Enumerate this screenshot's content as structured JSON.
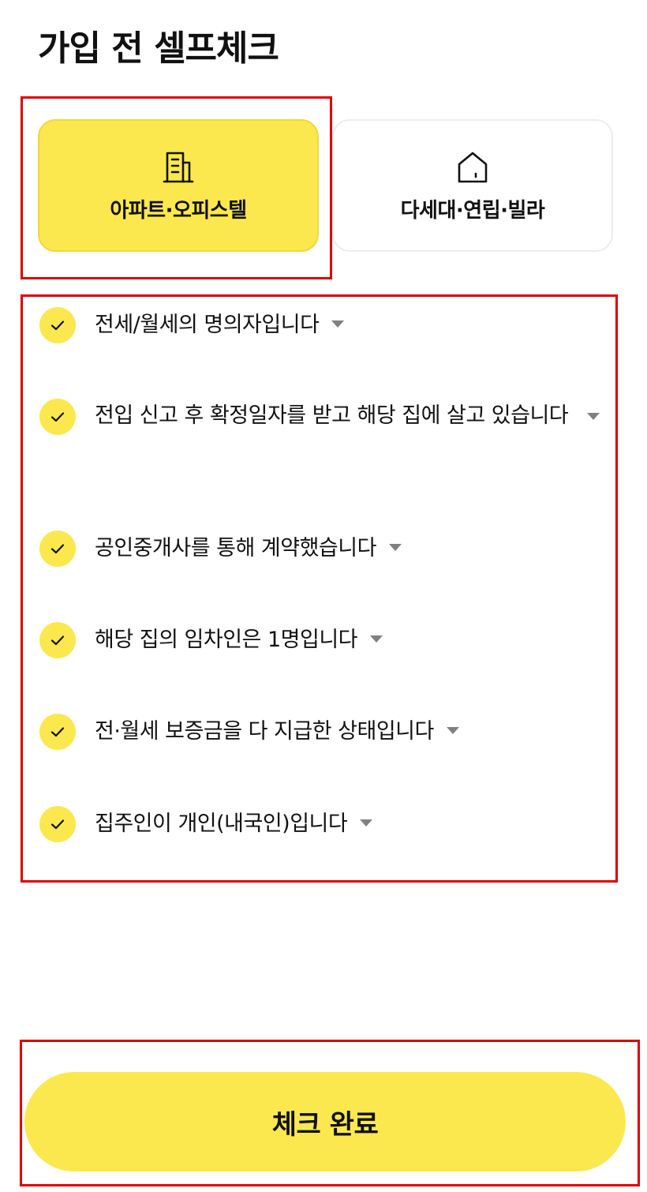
{
  "page": {
    "title": "가입 전 셀프체크"
  },
  "housing_types": [
    {
      "label": "아파트·오피스텔",
      "icon": "apartment-building-icon",
      "selected": true
    },
    {
      "label": "다세대·연립·빌라",
      "icon": "house-icon",
      "selected": false
    }
  ],
  "checklist": [
    {
      "text": "전세/월세의 명의자입니다",
      "checked": true
    },
    {
      "text": "전입 신고 후 확정일자를 받고 해당 집에 살고 있습니다",
      "checked": true
    },
    {
      "text": "공인중개사를 통해 계약했습니다",
      "checked": true
    },
    {
      "text": "해당 집의 임차인은 1명입니다",
      "checked": true
    },
    {
      "text": "전·월세 보증금을 다 지급한 상태입니다",
      "checked": true
    },
    {
      "text": "집주인이 개인(내국인)입니다",
      "checked": true
    }
  ],
  "footer": {
    "done_label": "체크 완료"
  },
  "colors": {
    "accent": "#fbe84e",
    "highlight_border": "#e00000",
    "caret": "#808080"
  }
}
